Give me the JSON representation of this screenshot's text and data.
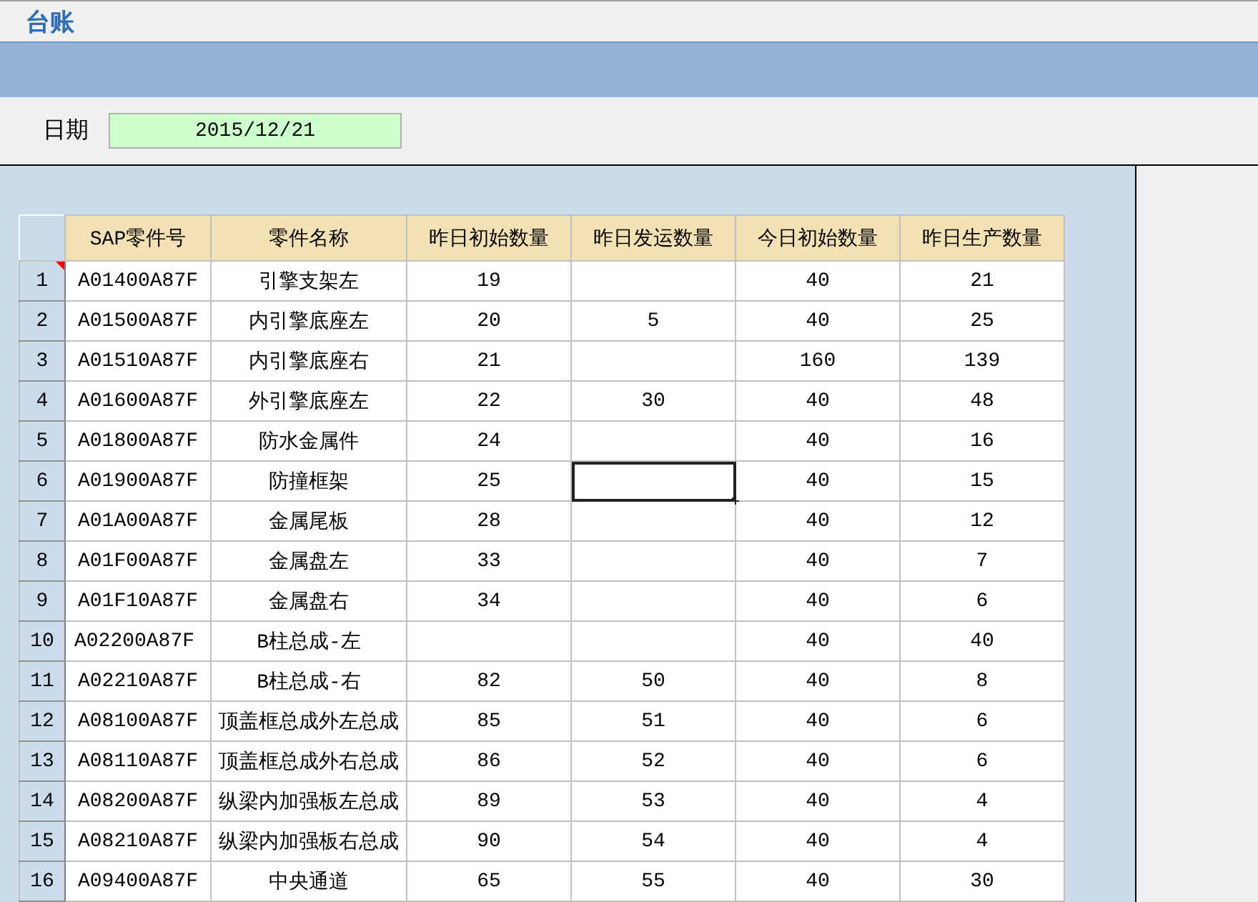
{
  "title": "台账",
  "date": {
    "label": "日期",
    "value": "2015/12/21"
  },
  "table": {
    "columns": [
      "SAP零件号",
      "零件名称",
      "昨日初始数量",
      "昨日发运数量",
      "今日初始数量",
      "昨日生产数量"
    ],
    "rows": [
      {
        "row": "1",
        "comment": true,
        "cells": [
          {
            "text": "A01400A87F",
            "selected": false
          },
          {
            "text": "引擎支架左",
            "selected": false
          },
          {
            "text": "19",
            "selected": false
          },
          {
            "selected": false
          },
          {
            "text": "40",
            "selected": false
          },
          {
            "text": "21",
            "selected": false
          }
        ]
      },
      {
        "row": "2",
        "comment": false,
        "cells": [
          {
            "text": "A01500A87F",
            "selected": false
          },
          {
            "text": "内引擎底座左",
            "selected": false
          },
          {
            "text": "20",
            "selected": false
          },
          {
            "text": "5",
            "selected": false
          },
          {
            "text": "40",
            "selected": false
          },
          {
            "text": "25",
            "selected": false
          }
        ]
      },
      {
        "row": "3",
        "comment": false,
        "cells": [
          {
            "text": "A01510A87F",
            "selected": false
          },
          {
            "text": "内引擎底座右",
            "selected": false
          },
          {
            "text": "21",
            "selected": false
          },
          {
            "selected": false
          },
          {
            "text": "160",
            "selected": false
          },
          {
            "text": "139",
            "selected": false
          }
        ]
      },
      {
        "row": "4",
        "comment": false,
        "cells": [
          {
            "text": "A01600A87F",
            "selected": false
          },
          {
            "text": "外引擎底座左",
            "selected": false
          },
          {
            "text": "22",
            "selected": false
          },
          {
            "text": "30",
            "selected": false
          },
          {
            "text": "40",
            "selected": false
          },
          {
            "text": "48",
            "selected": false
          }
        ]
      },
      {
        "row": "5",
        "comment": false,
        "cells": [
          {
            "text": "A01800A87F",
            "selected": false
          },
          {
            "text": "防水金属件",
            "selected": false
          },
          {
            "text": "24",
            "selected": false
          },
          {
            "selected": false
          },
          {
            "text": "40",
            "selected": false
          },
          {
            "text": "16",
            "selected": false
          }
        ]
      },
      {
        "row": "6",
        "comment": false,
        "cells": [
          {
            "text": "A01900A87F",
            "selected": false
          },
          {
            "text": "防撞框架",
            "selected": false
          },
          {
            "text": "25",
            "selected": false
          },
          {
            "selected": true
          },
          {
            "text": "40",
            "selected": false
          },
          {
            "text": "15",
            "selected": false
          }
        ]
      },
      {
        "row": "7",
        "comment": false,
        "cells": [
          {
            "text": "A01A00A87F",
            "selected": false
          },
          {
            "text": "金属尾板",
            "selected": false
          },
          {
            "text": "28",
            "selected": false
          },
          {
            "selected": false
          },
          {
            "text": "40",
            "selected": false
          },
          {
            "text": "12",
            "selected": false
          }
        ]
      },
      {
        "row": "8",
        "comment": false,
        "cells": [
          {
            "text": "A01F00A87F",
            "selected": false
          },
          {
            "text": "金属盘左",
            "selected": false
          },
          {
            "text": "33",
            "selected": false
          },
          {
            "selected": false
          },
          {
            "text": "40",
            "selected": false
          },
          {
            "text": "7",
            "selected": false
          }
        ]
      },
      {
        "row": "9",
        "comment": false,
        "cells": [
          {
            "text": "A01F10A87F",
            "selected": false
          },
          {
            "text": "金属盘右",
            "selected": false
          },
          {
            "text": "34",
            "selected": false
          },
          {
            "selected": false
          },
          {
            "text": "40",
            "selected": false
          },
          {
            "text": "6",
            "selected": false
          }
        ]
      },
      {
        "row": "10",
        "comment": false,
        "cells": [
          {
            "text": "A02200A87F",
            "selected": false
          },
          {
            "text": "B柱总成-左",
            "selected": false
          },
          {
            "selected": false
          },
          {
            "selected": false
          },
          {
            "text": "40",
            "selected": false
          },
          {
            "text": "40",
            "selected": false
          }
        ]
      },
      {
        "row": "11",
        "comment": false,
        "cells": [
          {
            "text": "A02210A87F",
            "selected": false
          },
          {
            "text": "B柱总成-右",
            "selected": false
          },
          {
            "text": "82",
            "selected": false
          },
          {
            "text": "50",
            "selected": false
          },
          {
            "text": "40",
            "selected": false
          },
          {
            "text": "8",
            "selected": false
          }
        ]
      },
      {
        "row": "12",
        "comment": false,
        "cells": [
          {
            "text": "A08100A87F",
            "selected": false
          },
          {
            "text": "顶盖框总成外左总成",
            "selected": false
          },
          {
            "text": "85",
            "selected": false
          },
          {
            "text": "51",
            "selected": false
          },
          {
            "text": "40",
            "selected": false
          },
          {
            "text": "6",
            "selected": false
          }
        ]
      },
      {
        "row": "13",
        "comment": false,
        "cells": [
          {
            "text": "A08110A87F",
            "selected": false
          },
          {
            "text": "顶盖框总成外右总成",
            "selected": false
          },
          {
            "text": "86",
            "selected": false
          },
          {
            "text": "52",
            "selected": false
          },
          {
            "text": "40",
            "selected": false
          },
          {
            "text": "6",
            "selected": false
          }
        ]
      },
      {
        "row": "14",
        "comment": false,
        "cells": [
          {
            "text": "A08200A87F",
            "selected": false
          },
          {
            "text": "纵梁内加强板左总成",
            "selected": false
          },
          {
            "text": "89",
            "selected": false
          },
          {
            "text": "53",
            "selected": false
          },
          {
            "text": "40",
            "selected": false
          },
          {
            "text": "4",
            "selected": false
          }
        ]
      },
      {
        "row": "15",
        "comment": false,
        "cells": [
          {
            "text": "A08210A87F",
            "selected": false
          },
          {
            "text": "纵梁内加强板右总成",
            "selected": false
          },
          {
            "text": "90",
            "selected": false
          },
          {
            "text": "54",
            "selected": false
          },
          {
            "text": "40",
            "selected": false
          },
          {
            "text": "4",
            "selected": false
          }
        ]
      },
      {
        "row": "16",
        "comment": false,
        "cells": [
          {
            "text": "A09400A87F",
            "selected": false
          },
          {
            "text": "中央通道",
            "selected": false
          },
          {
            "text": "65",
            "selected": false
          },
          {
            "text": "55",
            "selected": false
          },
          {
            "text": "40",
            "selected": false
          },
          {
            "text": "30",
            "selected": false
          }
        ]
      }
    ]
  }
}
